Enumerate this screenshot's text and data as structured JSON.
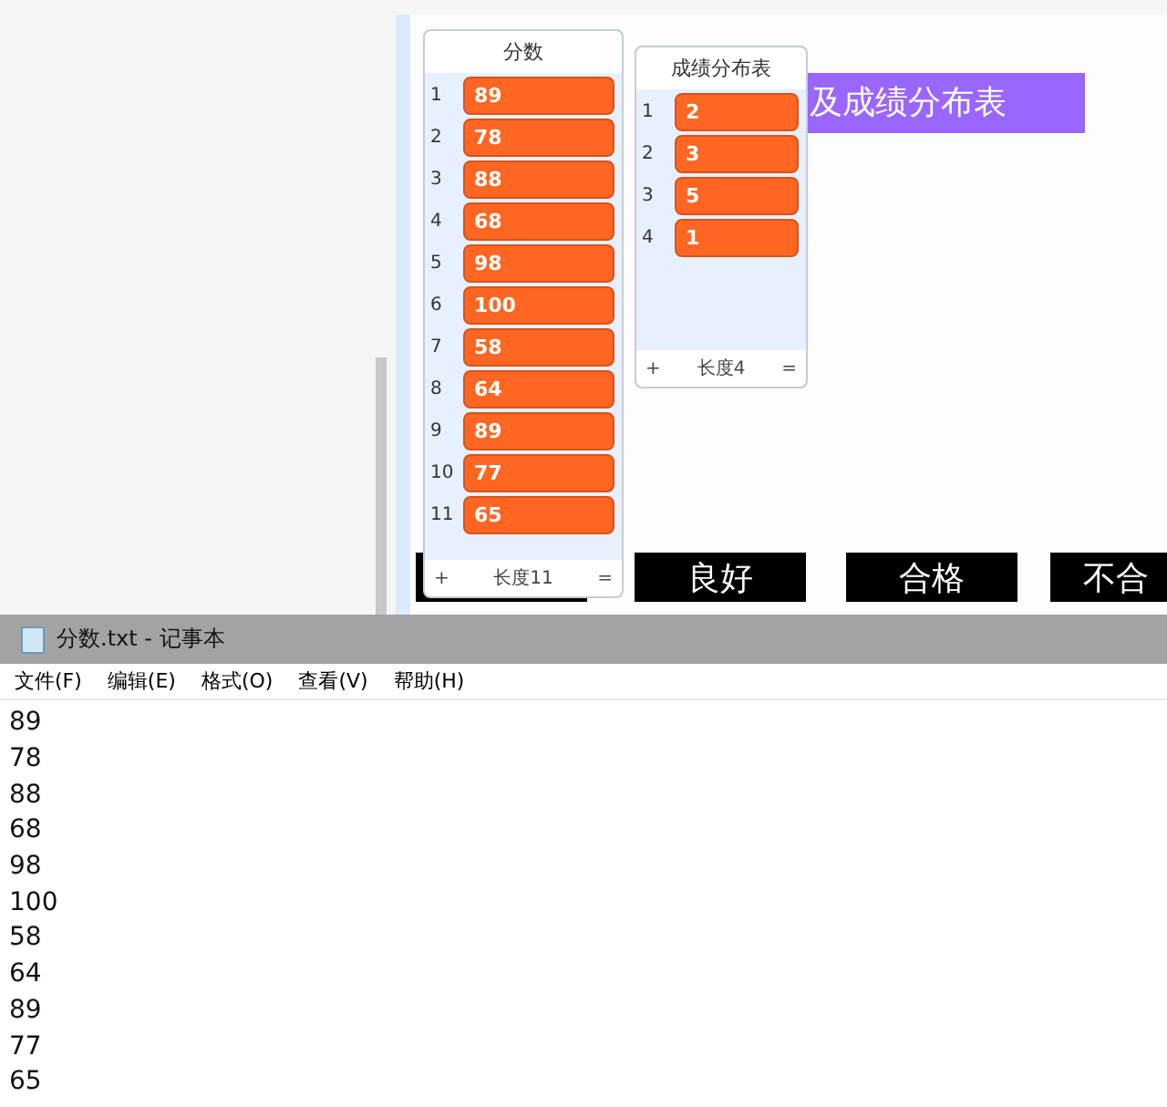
{
  "stage": {
    "banner": "及成绩分布表",
    "labels": [
      {
        "kind": "covered"
      },
      {
        "kind": "text",
        "text": "良好"
      },
      {
        "kind": "text",
        "text": "合格"
      },
      {
        "kind": "text",
        "text": "不合"
      }
    ],
    "lists": [
      {
        "title": "分数",
        "items": [
          {
            "index": "1",
            "value": "89"
          },
          {
            "index": "2",
            "value": "78"
          },
          {
            "index": "3",
            "value": "88"
          },
          {
            "index": "4",
            "value": "68"
          },
          {
            "index": "5",
            "value": "98"
          },
          {
            "index": "6",
            "value": "100"
          },
          {
            "index": "7",
            "value": "58"
          },
          {
            "index": "8",
            "value": "64"
          },
          {
            "index": "9",
            "value": "89"
          },
          {
            "index": "10",
            "value": "77"
          },
          {
            "index": "11",
            "value": "65"
          }
        ],
        "add": "+",
        "length": "长度11",
        "resize": "="
      },
      {
        "title": "成绩分布表",
        "items": [
          {
            "index": "1",
            "value": "2"
          },
          {
            "index": "2",
            "value": "3"
          },
          {
            "index": "3",
            "value": "5"
          },
          {
            "index": "4",
            "value": "1"
          }
        ],
        "add": "+",
        "length": "长度4",
        "resize": "="
      }
    ]
  },
  "notepad": {
    "title": "分数.txt - 记事本",
    "menu": [
      "文件(F)",
      "编辑(E)",
      "格式(O)",
      "查看(V)",
      "帮助(H)"
    ],
    "lines": [
      "89",
      "78",
      "88",
      "68",
      "98",
      "100",
      "58",
      "64",
      "89",
      "77",
      "65"
    ]
  }
}
